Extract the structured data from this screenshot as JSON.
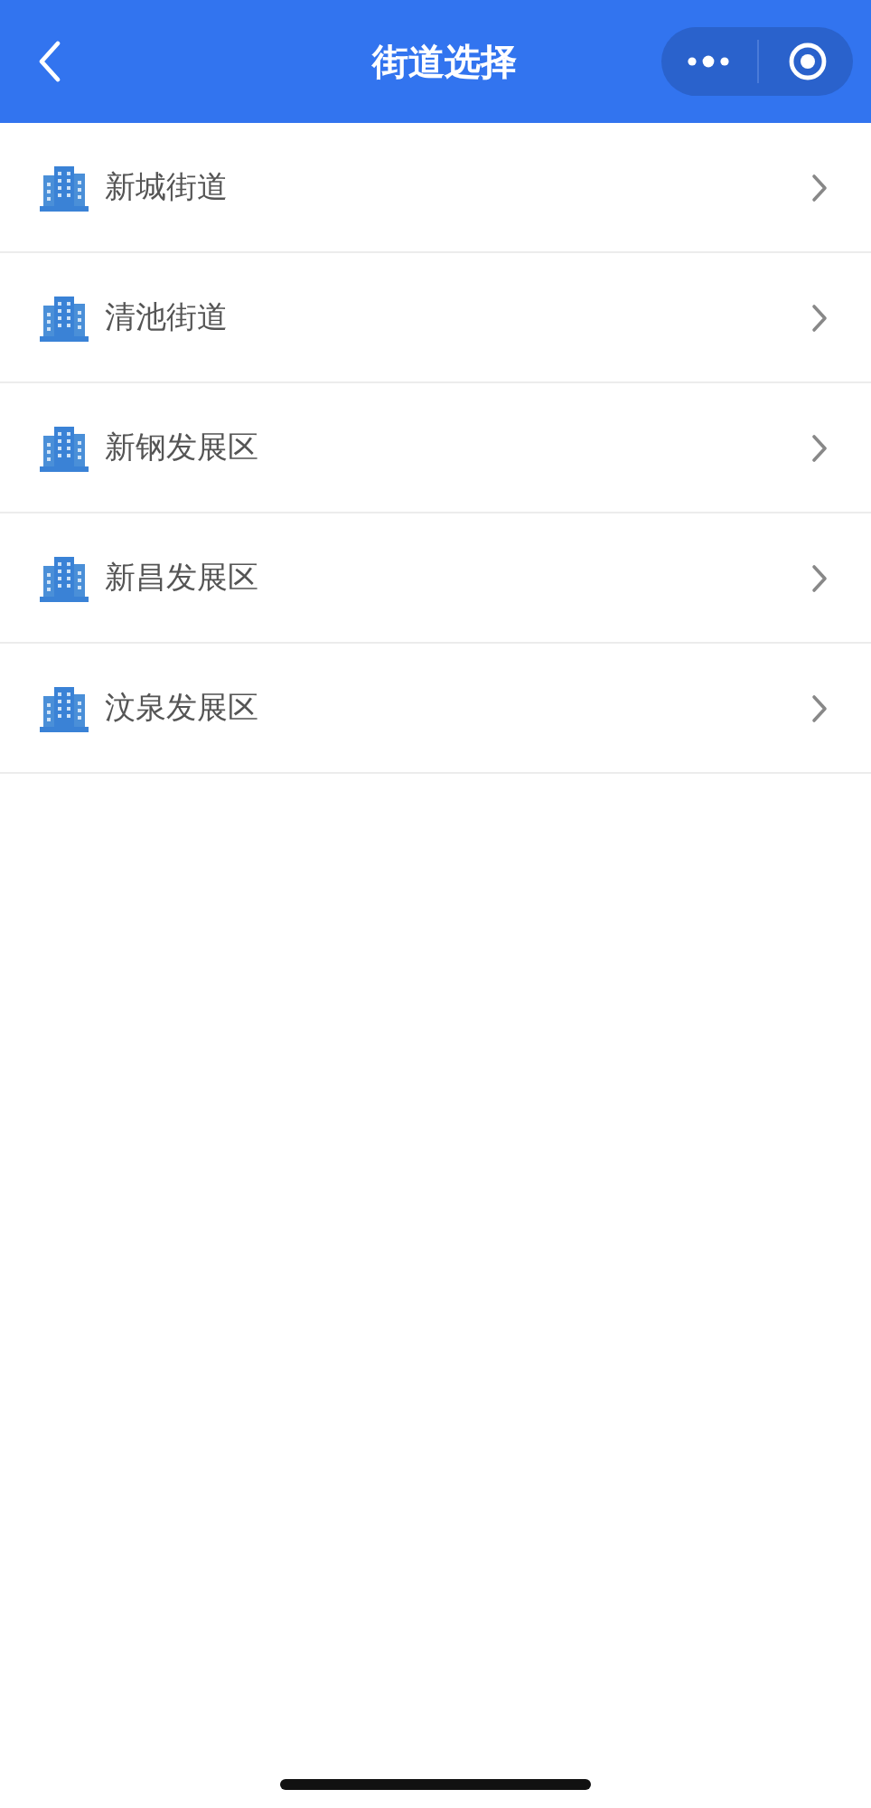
{
  "header": {
    "title": "街道选择"
  },
  "streets": [
    {
      "name": "新城街道"
    },
    {
      "name": "清池街道"
    },
    {
      "name": "新钢发展区"
    },
    {
      "name": "新昌发展区"
    },
    {
      "name": "汶泉发展区"
    }
  ]
}
